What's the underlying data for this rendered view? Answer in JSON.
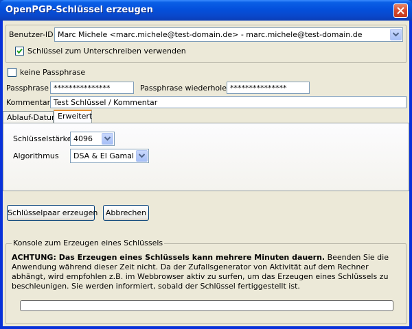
{
  "window": {
    "title": "OpenPGP-Schlüssel erzeugen"
  },
  "identity": {
    "label": "Benutzer-ID",
    "selected": "Marc Michele <marc.michele@test-domain.de> - marc.michele@test-domain.de",
    "sign_checkbox_label": "Schlüssel zum Unterschreiben verwenden",
    "sign_checked": true
  },
  "passphrase": {
    "no_pass_label": "keine Passphrase",
    "no_pass_checked": false,
    "pass_label": "Passphrase",
    "pass_value": "***************",
    "repeat_label": "Passphrase wiederholen",
    "repeat_value": "***************"
  },
  "comment": {
    "label": "Kommentar",
    "value": "Test Schlüssel / Kommentar"
  },
  "tabs": [
    {
      "label": "Ablauf-Datum",
      "active": false
    },
    {
      "label": "Erweitert",
      "active": true
    }
  ],
  "advanced": {
    "keysize_label": "Schlüsselstärke",
    "keysize_value": "4096",
    "algorithm_label": "Algorithmus",
    "algorithm_value": "DSA & El Gamal"
  },
  "buttons": {
    "generate": "Schlüsselpaar erzeugen",
    "cancel": "Abbrechen"
  },
  "console": {
    "legend": "Konsole zum Erzeugen eines Schlüssels",
    "warning_bold": "ACHTUNG: Das Erzeugen eines Schlüssels kann mehrere Minuten dauern.",
    "warning_text": " Beenden Sie die Anwendung während dieser Zeit nicht. Da der Zufallsgenerator von Aktivität auf dem Rechner abhängt, wird empfohlen z.B. im Webbrowser aktiv zu surfen, um das Erzeugen eines Schlüssels zu beschleunigen. Sie werden informiert, sobald der Schlüssel fertiggestellt ist.",
    "progress": 0
  }
}
